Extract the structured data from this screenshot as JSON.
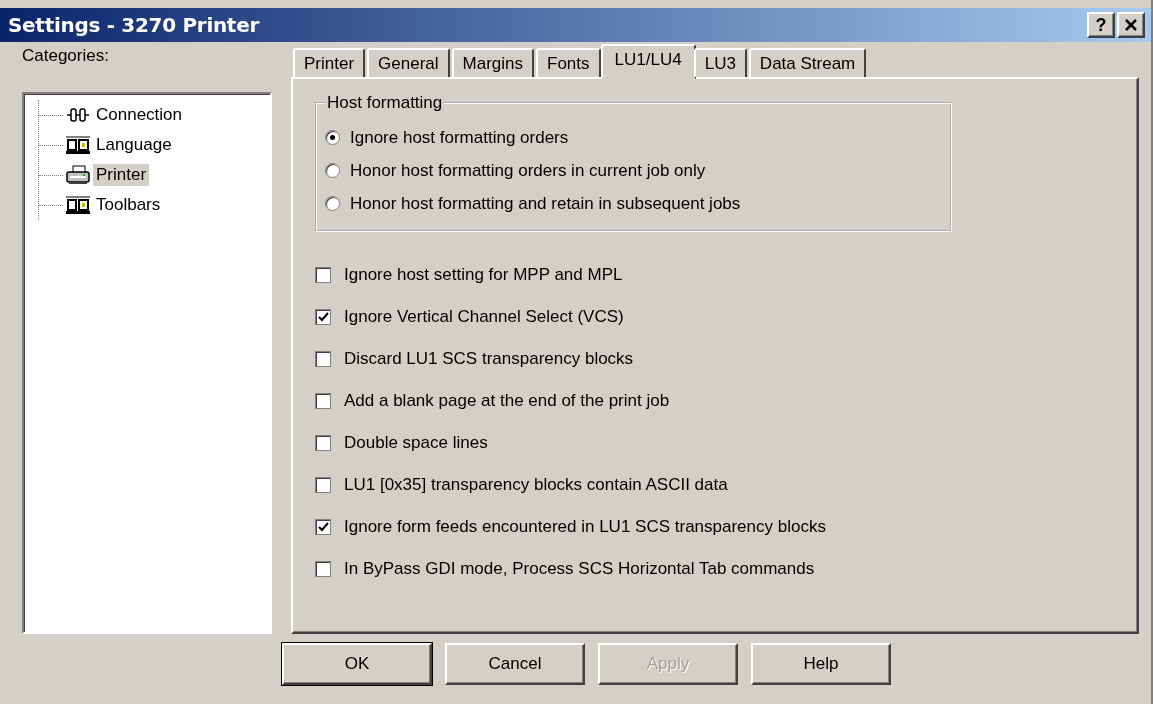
{
  "window": {
    "title": "Settings - 3270 Printer",
    "help_button": "?"
  },
  "categories": {
    "label": "Categories:",
    "items": [
      {
        "label": "Connection",
        "kind": "connection",
        "selected": false
      },
      {
        "label": "Language",
        "kind": "panel",
        "selected": false
      },
      {
        "label": "Printer",
        "kind": "printer",
        "selected": true
      },
      {
        "label": "Toolbars",
        "kind": "panel",
        "selected": false
      }
    ]
  },
  "tabs": [
    {
      "label": "Printer",
      "selected": false
    },
    {
      "label": "General",
      "selected": false
    },
    {
      "label": "Margins",
      "selected": false
    },
    {
      "label": "Fonts",
      "selected": false
    },
    {
      "label": "LU1/LU4",
      "selected": true
    },
    {
      "label": "LU3",
      "selected": false
    },
    {
      "label": "Data Stream",
      "selected": false
    }
  ],
  "host_formatting": {
    "title": "Host formatting",
    "options": [
      {
        "label": "Ignore host formatting orders",
        "selected": true
      },
      {
        "label": "Honor host formatting orders in current job only",
        "selected": false
      },
      {
        "label": "Honor host formatting and retain in subsequent jobs",
        "selected": false
      }
    ]
  },
  "options": [
    {
      "label": "Ignore host setting for MPP and MPL",
      "checked": false
    },
    {
      "label": "Ignore Vertical Channel Select (VCS)",
      "checked": true
    },
    {
      "label": "Discard LU1 SCS transparency blocks",
      "checked": false
    },
    {
      "label": "Add a blank page at the end of the print job",
      "checked": false
    },
    {
      "label": "Double space lines",
      "checked": false
    },
    {
      "label": "LU1 [0x35] transparency blocks contain ASCII data",
      "checked": false
    },
    {
      "label": "Ignore form feeds encountered in LU1 SCS transparency blocks",
      "checked": true
    },
    {
      "label": "In ByPass GDI mode, Process SCS Horizontal Tab commands",
      "checked": false
    }
  ],
  "buttons": [
    {
      "label": "OK",
      "default": true,
      "disabled": false
    },
    {
      "label": "Cancel",
      "default": false,
      "disabled": false
    },
    {
      "label": "Apply",
      "default": false,
      "disabled": true
    },
    {
      "label": "Help",
      "default": false,
      "disabled": false
    }
  ]
}
